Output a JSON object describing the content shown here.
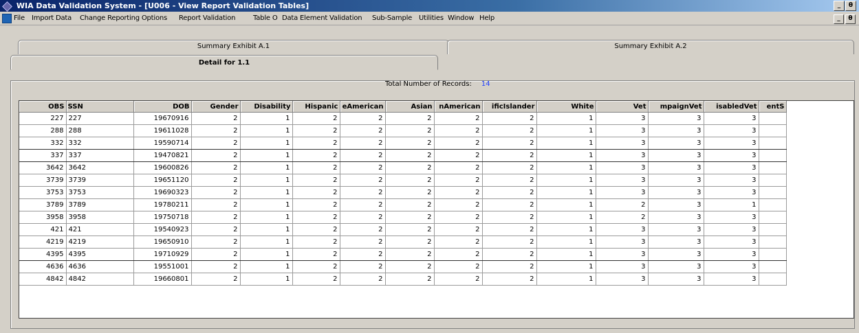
{
  "window": {
    "title": "WIA Data Validation System - [U006 - View Report Validation Tables]",
    "min_label": "_",
    "restore_label": "θ"
  },
  "menu": [
    "File",
    "Import Data",
    "Change Reporting Options",
    "Report Validation",
    "Table O",
    "Data Element Validation",
    "Sub-Sample",
    "Utilities",
    "Window",
    "Help"
  ],
  "tabs": {
    "exhibit_a1": "Summary Exhibit A.1",
    "exhibit_a2": "Summary Exhibit A.2",
    "detail": "Detail for 1.1"
  },
  "records": {
    "label": "Total Number of Records:",
    "count": "14"
  },
  "table": {
    "columns": [
      "OBS",
      "SSN",
      "DOB",
      "Gender",
      "Disability",
      "Hispanic",
      "eAmerican",
      "Asian",
      "nAmerican",
      "ificIslander",
      "White",
      "Vet",
      "mpaignVet",
      "isabledVet",
      "entS"
    ],
    "rows": [
      [
        "227",
        "227",
        "19670916",
        "2",
        "1",
        "2",
        "2",
        "2",
        "2",
        "2",
        "1",
        "3",
        "3",
        "3",
        ""
      ],
      [
        "288",
        "288",
        "19611028",
        "2",
        "1",
        "2",
        "2",
        "2",
        "2",
        "2",
        "1",
        "3",
        "3",
        "3",
        ""
      ],
      [
        "332",
        "332",
        "19590714",
        "2",
        "1",
        "2",
        "2",
        "2",
        "2",
        "2",
        "1",
        "3",
        "3",
        "3",
        ""
      ],
      [
        "337",
        "337",
        "19470821",
        "2",
        "1",
        "2",
        "2",
        "2",
        "2",
        "2",
        "1",
        "3",
        "3",
        "3",
        ""
      ],
      [
        "3642",
        "3642",
        "19600826",
        "2",
        "1",
        "2",
        "2",
        "2",
        "2",
        "2",
        "1",
        "3",
        "3",
        "3",
        ""
      ],
      [
        "3739",
        "3739",
        "19651120",
        "2",
        "1",
        "2",
        "2",
        "2",
        "2",
        "2",
        "1",
        "3",
        "3",
        "3",
        ""
      ],
      [
        "3753",
        "3753",
        "19690323",
        "2",
        "1",
        "2",
        "2",
        "2",
        "2",
        "2",
        "1",
        "3",
        "3",
        "3",
        ""
      ],
      [
        "3789",
        "3789",
        "19780211",
        "2",
        "1",
        "2",
        "2",
        "2",
        "2",
        "2",
        "1",
        "2",
        "3",
        "1",
        ""
      ],
      [
        "3958",
        "3958",
        "19750718",
        "2",
        "1",
        "2",
        "2",
        "2",
        "2",
        "2",
        "1",
        "2",
        "3",
        "3",
        ""
      ],
      [
        "421",
        "421",
        "19540923",
        "2",
        "1",
        "2",
        "2",
        "2",
        "2",
        "2",
        "1",
        "3",
        "3",
        "3",
        ""
      ],
      [
        "4219",
        "4219",
        "19650910",
        "2",
        "1",
        "2",
        "2",
        "2",
        "2",
        "2",
        "1",
        "3",
        "3",
        "3",
        ""
      ],
      [
        "4395",
        "4395",
        "19710929",
        "2",
        "1",
        "2",
        "2",
        "2",
        "2",
        "2",
        "1",
        "3",
        "3",
        "3",
        ""
      ],
      [
        "4636",
        "4636",
        "19551001",
        "2",
        "1",
        "2",
        "2",
        "2",
        "2",
        "2",
        "1",
        "3",
        "3",
        "3",
        ""
      ],
      [
        "4842",
        "4842",
        "19660801",
        "2",
        "1",
        "2",
        "2",
        "2",
        "2",
        "2",
        "1",
        "3",
        "3",
        "3",
        ""
      ]
    ]
  }
}
